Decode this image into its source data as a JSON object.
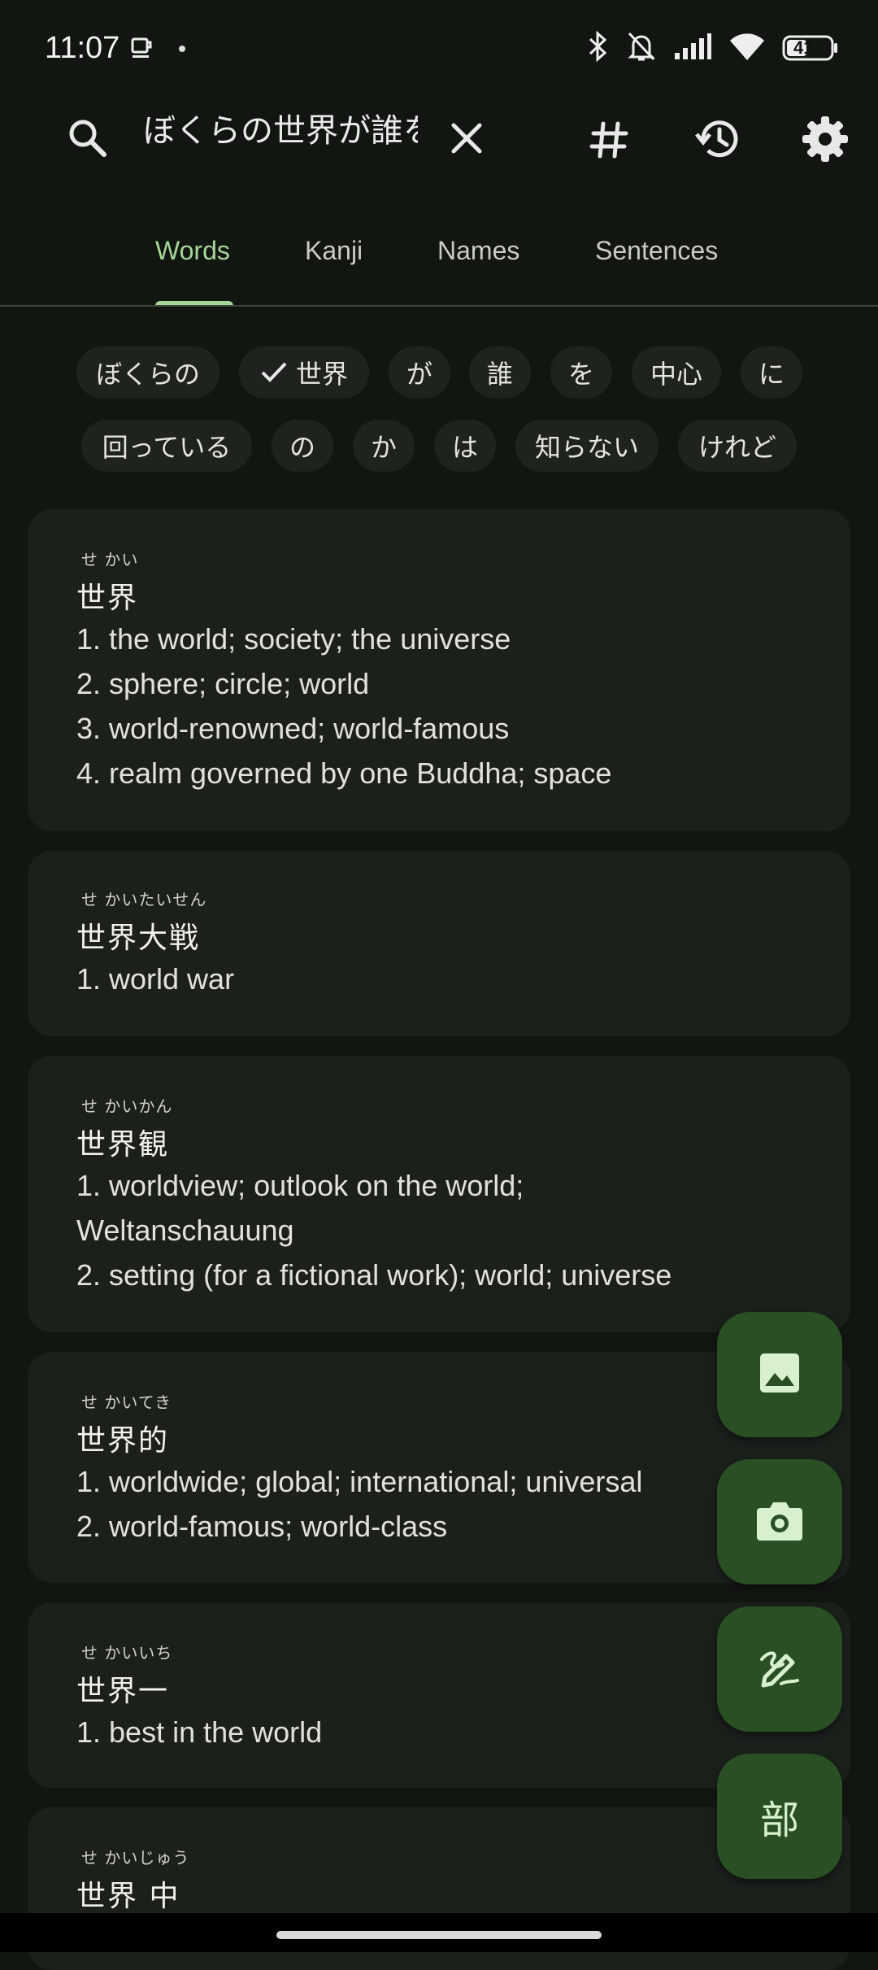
{
  "status_bar": {
    "time": "11:07",
    "battery": "41",
    "icons": [
      "coffee-icon",
      "dot-icon",
      "bluetooth-icon",
      "bell-off-icon",
      "signal-icon",
      "wifi-icon",
      "battery-icon"
    ]
  },
  "search": {
    "query": "ぼくらの世界が誰を",
    "icons": [
      "search-icon",
      "clear-icon",
      "hash-icon",
      "history-icon",
      "settings-icon"
    ]
  },
  "tabs": [
    {
      "label": "Words",
      "active": true
    },
    {
      "label": "Kanji",
      "active": false
    },
    {
      "label": "Names",
      "active": false
    },
    {
      "label": "Sentences",
      "active": false
    }
  ],
  "tokens": [
    {
      "text": "ぼくらの",
      "selected": false
    },
    {
      "text": "世界",
      "selected": true
    },
    {
      "text": "が",
      "selected": false
    },
    {
      "text": "誰",
      "selected": false
    },
    {
      "text": "を",
      "selected": false
    },
    {
      "text": "中心",
      "selected": false
    },
    {
      "text": "に",
      "selected": false
    },
    {
      "text": "回っている",
      "selected": false
    },
    {
      "text": "の",
      "selected": false
    },
    {
      "text": "か",
      "selected": false
    },
    {
      "text": "は",
      "selected": false
    },
    {
      "text": "知らない",
      "selected": false
    },
    {
      "text": "けれど",
      "selected": false
    }
  ],
  "results": [
    {
      "reading": "せ かい",
      "word": "世界",
      "defs": [
        "1. the world; society; the universe",
        "2. sphere; circle; world",
        "3. world-renowned; world-famous",
        "4. realm governed by one Buddha; space"
      ]
    },
    {
      "reading": "せ かいたいせん",
      "word": "世界大戦",
      "defs": [
        "1. world war"
      ]
    },
    {
      "reading": "せ かいかん",
      "word": "世界観",
      "defs": [
        "1. worldview; outlook on the world;",
        "Weltanschauung",
        "2. setting (for a fictional work); world; universe"
      ]
    },
    {
      "reading": "せ かいてき",
      "word": "世界的",
      "defs": [
        "1. worldwide; global; international; universal",
        "2. world-famous; world-class"
      ]
    },
    {
      "reading": "せ かいいち",
      "word": "世界一",
      "defs": [
        "1. best in the world"
      ]
    },
    {
      "reading": "せ かいじゅう",
      "word": "世界 中",
      "defs": []
    }
  ],
  "fabs": {
    "image": "image-icon",
    "camera": "camera-icon",
    "draw": "draw-icon",
    "radical_label": "部"
  },
  "colors": {
    "background": "#121611",
    "card": "#1b201b",
    "accent": "#a7d69a",
    "fab": "#2a4f25"
  }
}
